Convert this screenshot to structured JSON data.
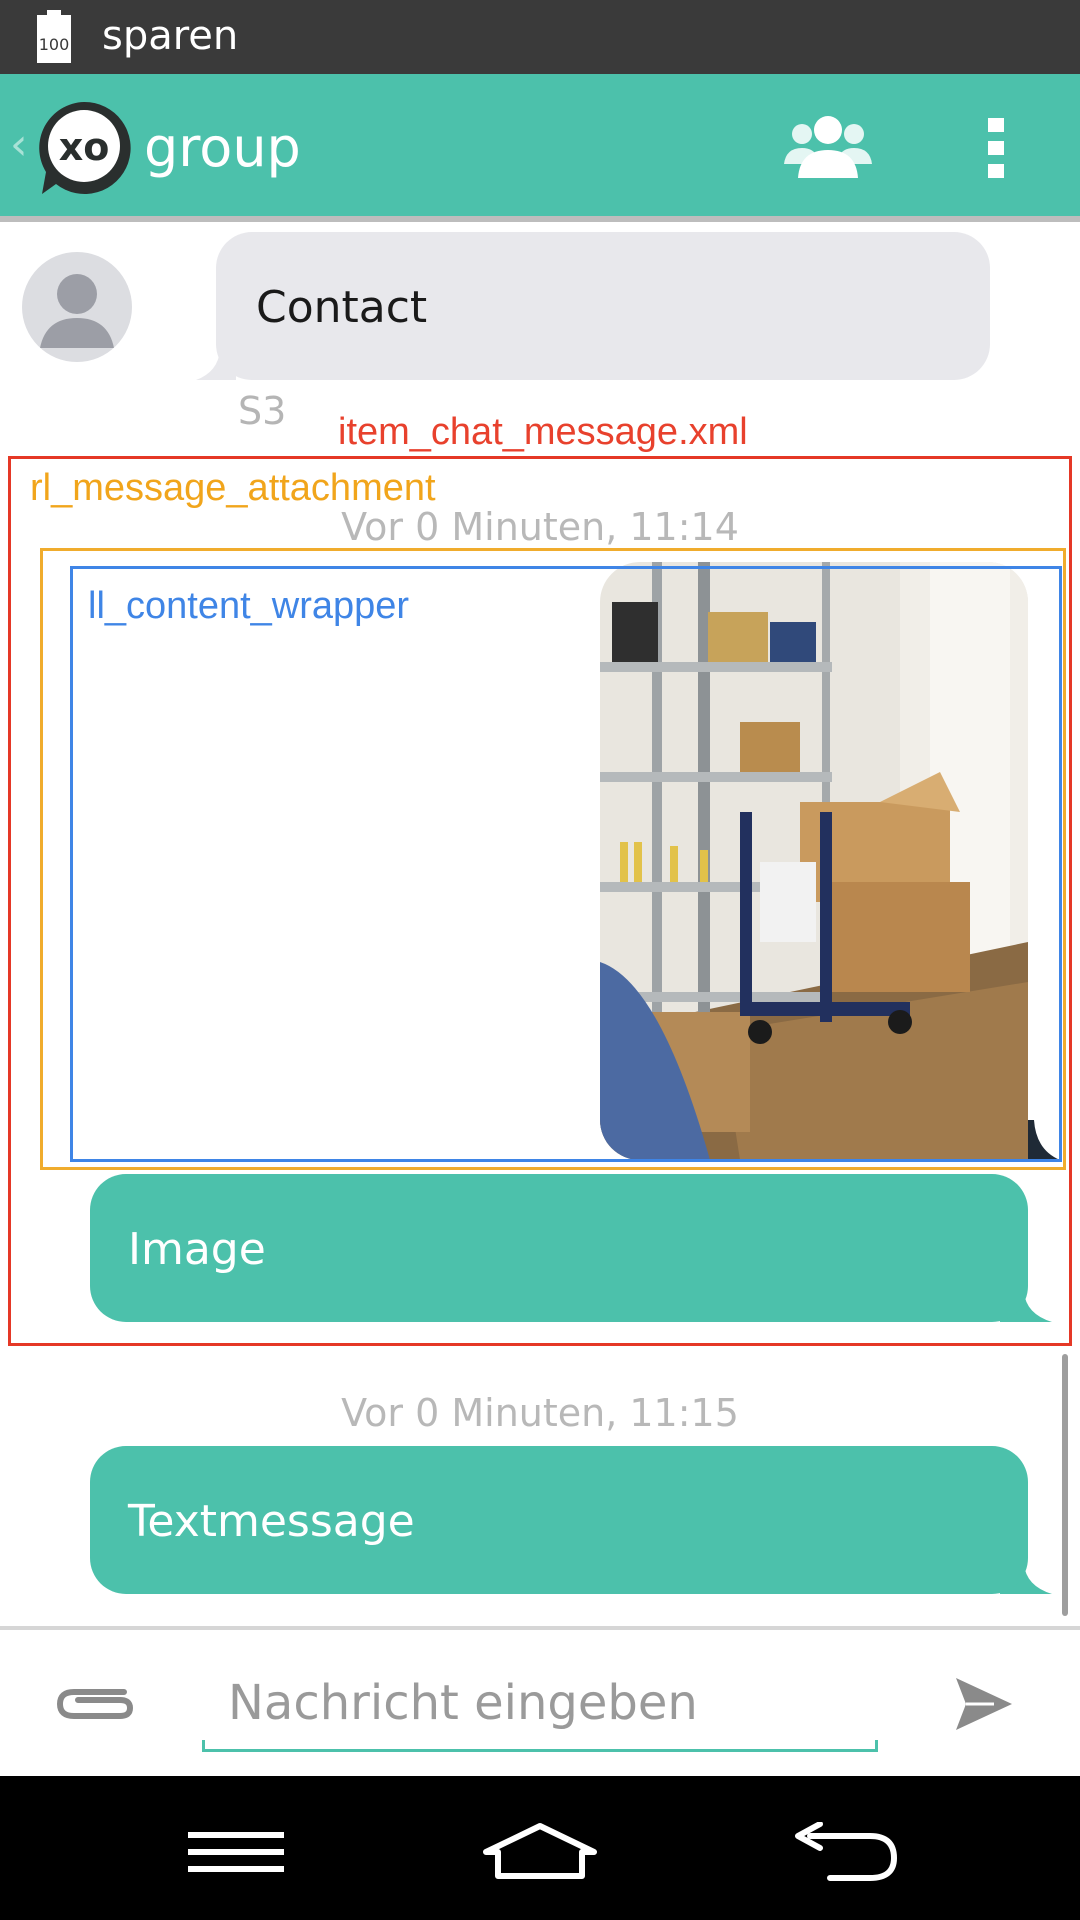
{
  "status_bar": {
    "text": "sparen",
    "battery_level": "100",
    "battery_icon": "battery-icon"
  },
  "action_bar": {
    "title": "group",
    "back_icon": "‹",
    "logo_text": "xo",
    "group_icon": "group-icon",
    "overflow_icon": "overflow-menu-icon",
    "color": "#4cc1ab"
  },
  "messages": {
    "incoming": {
      "text": "Contact",
      "sender": "S3"
    },
    "attachment": {
      "timestamp": "Vor 0 Minuten, 11:14",
      "caption": "Image"
    },
    "text_message": {
      "timestamp": "Vor 0 Minuten, 11:15",
      "text": "Textmessage"
    }
  },
  "debug_labels": {
    "item": "item_chat_message.xml",
    "attachment": "rl_message_attachment",
    "content_wrapper": "ll_content_wrapper",
    "item_color": "#e53826",
    "attachment_color": "#f0ac2d",
    "wrapper_color": "#3f85e6"
  },
  "compose": {
    "placeholder": "Nachricht eingeben",
    "value": "",
    "attach_icon": "paperclip-icon",
    "send_icon": "send-icon"
  },
  "nav_bar": {
    "menu_icon": "menu-icon",
    "home_icon": "home-icon",
    "back_icon": "back-icon"
  }
}
